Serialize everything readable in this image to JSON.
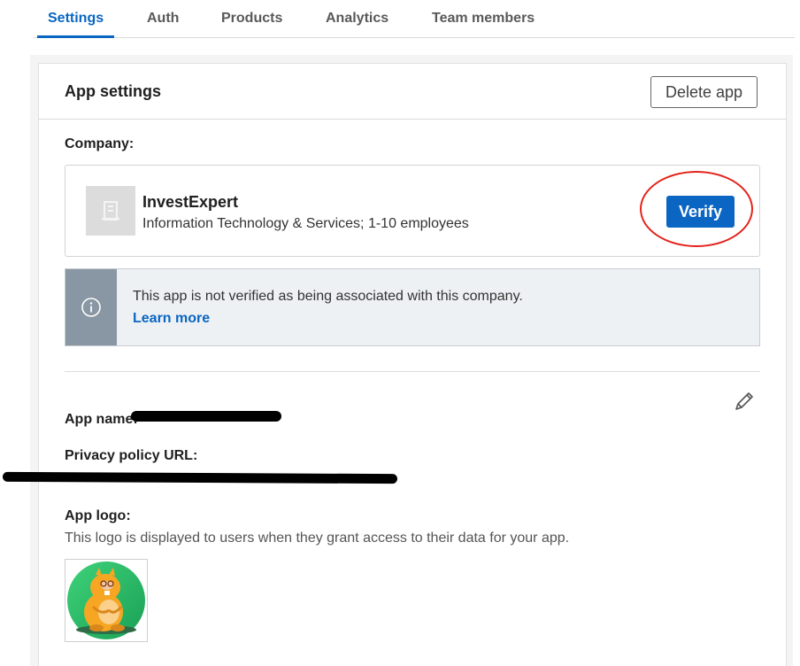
{
  "tabs": [
    {
      "label": "Settings",
      "active": true
    },
    {
      "label": "Auth"
    },
    {
      "label": "Products"
    },
    {
      "label": "Analytics"
    },
    {
      "label": "Team members"
    }
  ],
  "card": {
    "title": "App settings",
    "delete_label": "Delete app"
  },
  "company": {
    "label": "Company:",
    "name": "InvestExpert",
    "description": "Information Technology & Services; 1-10 employees",
    "verify_label": "Verify"
  },
  "notice": {
    "text": "This app is not verified as being associated with this company.",
    "link": "Learn more"
  },
  "details": {
    "app_name_label": "App name:",
    "privacy_label": "Privacy policy URL:",
    "logo_label": "App logo:",
    "logo_desc": "This logo is displayed to users when they grant access to their data for your app."
  },
  "colors": {
    "accent": "#0a66c2",
    "annotation": "#e3231b",
    "info_side": "#8996a3"
  },
  "icons": [
    "building-icon",
    "info-icon",
    "pencil-icon",
    "app-logo-image"
  ]
}
